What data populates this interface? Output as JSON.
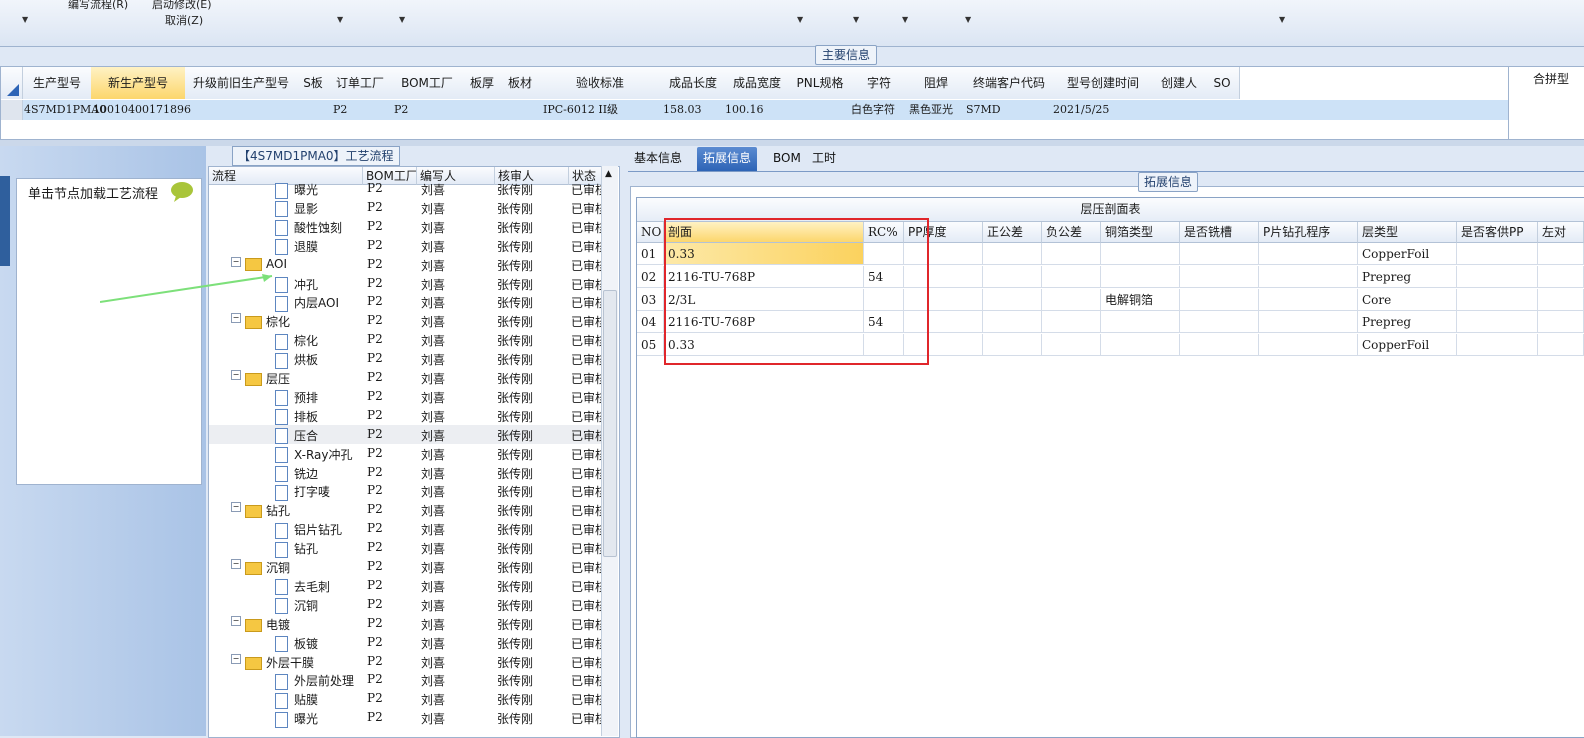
{
  "toolbar": {
    "item_edit_flow": "编写流程(R)",
    "item_start_edit": "启动修改(E)",
    "item_cancel": "取消(Z)"
  },
  "main_info": {
    "title": "主要信息",
    "columns": [
      "生产型号",
      "新生产型号",
      "升级前旧生产型号",
      "S板",
      "订单工厂",
      "BOM工厂",
      "板厚",
      "板材",
      "验收标准",
      "成品长度",
      "成品宽度",
      "PNL规格",
      "字符",
      "阻焊",
      "终端客户代码",
      "型号创建时间",
      "创建人",
      "SO"
    ],
    "row": {
      "prod_model": "4S7MD1PMA0",
      "new_prod_model": "10010400171896",
      "order_factory": "P2",
      "bom_factory": "P2",
      "acceptance": "IPC-6012 II级",
      "length": "158.03",
      "width": "100.16",
      "character": "白色字符",
      "solder_mask": "黑色亚光",
      "customer_code": "S7MD",
      "created": "2021/5/25"
    },
    "right_header": "合拼型"
  },
  "left_panel": {
    "hint": "单击节点加载工艺流程"
  },
  "process_tree": {
    "title": "【4S7MD1PMA0】工艺流程",
    "columns": [
      "流程",
      "BOM工厂",
      "编写人",
      "核审人",
      "状态"
    ],
    "rows": [
      {
        "indent": 2,
        "type": "doc",
        "name": "曝光",
        "bom": "P2",
        "writer": "刘喜",
        "reviewer": "张传刚",
        "status": "已审核"
      },
      {
        "indent": 2,
        "type": "doc",
        "name": "显影",
        "bom": "P2",
        "writer": "刘喜",
        "reviewer": "张传刚",
        "status": "已审核"
      },
      {
        "indent": 2,
        "type": "doc",
        "name": "酸性蚀刻",
        "bom": "P2",
        "writer": "刘喜",
        "reviewer": "张传刚",
        "status": "已审核"
      },
      {
        "indent": 2,
        "type": "doc",
        "name": "退膜",
        "bom": "P2",
        "writer": "刘喜",
        "reviewer": "张传刚",
        "status": "已审核"
      },
      {
        "indent": 1,
        "type": "folder",
        "name": "AOI",
        "bom": "P2",
        "writer": "刘喜",
        "reviewer": "张传刚",
        "status": "已审核"
      },
      {
        "indent": 2,
        "type": "doc",
        "name": "冲孔",
        "bom": "P2",
        "writer": "刘喜",
        "reviewer": "张传刚",
        "status": "已审核"
      },
      {
        "indent": 2,
        "type": "doc",
        "name": "内层AOI",
        "bom": "P2",
        "writer": "刘喜",
        "reviewer": "张传刚",
        "status": "已审核"
      },
      {
        "indent": 1,
        "type": "folder",
        "name": "棕化",
        "bom": "P2",
        "writer": "刘喜",
        "reviewer": "张传刚",
        "status": "已审核"
      },
      {
        "indent": 2,
        "type": "doc",
        "name": "棕化",
        "bom": "P2",
        "writer": "刘喜",
        "reviewer": "张传刚",
        "status": "已审核"
      },
      {
        "indent": 2,
        "type": "doc",
        "name": "烘板",
        "bom": "P2",
        "writer": "刘喜",
        "reviewer": "张传刚",
        "status": "已审核"
      },
      {
        "indent": 1,
        "type": "folder",
        "name": "层压",
        "bom": "P2",
        "writer": "刘喜",
        "reviewer": "张传刚",
        "status": "已审核"
      },
      {
        "indent": 2,
        "type": "doc",
        "name": "预排",
        "bom": "P2",
        "writer": "刘喜",
        "reviewer": "张传刚",
        "status": "已审核"
      },
      {
        "indent": 2,
        "type": "doc",
        "name": "排板",
        "bom": "P2",
        "writer": "刘喜",
        "reviewer": "张传刚",
        "status": "已审核"
      },
      {
        "indent": 2,
        "type": "doc",
        "name": "压合",
        "bom": "P2",
        "writer": "刘喜",
        "reviewer": "张传刚",
        "status": "已审核",
        "selected": true
      },
      {
        "indent": 2,
        "type": "doc",
        "name": "X-Ray冲孔",
        "bom": "P2",
        "writer": "刘喜",
        "reviewer": "张传刚",
        "status": "已审核"
      },
      {
        "indent": 2,
        "type": "doc",
        "name": "铣边",
        "bom": "P2",
        "writer": "刘喜",
        "reviewer": "张传刚",
        "status": "已审核"
      },
      {
        "indent": 2,
        "type": "doc",
        "name": "打字唛",
        "bom": "P2",
        "writer": "刘喜",
        "reviewer": "张传刚",
        "status": "已审核"
      },
      {
        "indent": 1,
        "type": "folder",
        "name": "钻孔",
        "bom": "P2",
        "writer": "刘喜",
        "reviewer": "张传刚",
        "status": "已审核"
      },
      {
        "indent": 2,
        "type": "doc",
        "name": "铝片钻孔",
        "bom": "P2",
        "writer": "刘喜",
        "reviewer": "张传刚",
        "status": "已审核"
      },
      {
        "indent": 2,
        "type": "doc",
        "name": "钻孔",
        "bom": "P2",
        "writer": "刘喜",
        "reviewer": "张传刚",
        "status": "已审核"
      },
      {
        "indent": 1,
        "type": "folder",
        "name": "沉铜",
        "bom": "P2",
        "writer": "刘喜",
        "reviewer": "张传刚",
        "status": "已审核"
      },
      {
        "indent": 2,
        "type": "doc",
        "name": "去毛刺",
        "bom": "P2",
        "writer": "刘喜",
        "reviewer": "张传刚",
        "status": "已审核"
      },
      {
        "indent": 2,
        "type": "doc",
        "name": "沉铜",
        "bom": "P2",
        "writer": "刘喜",
        "reviewer": "张传刚",
        "status": "已审核"
      },
      {
        "indent": 1,
        "type": "folder",
        "name": "电镀",
        "bom": "P2",
        "writer": "刘喜",
        "reviewer": "张传刚",
        "status": "已审核"
      },
      {
        "indent": 2,
        "type": "doc",
        "name": "板镀",
        "bom": "P2",
        "writer": "刘喜",
        "reviewer": "张传刚",
        "status": "已审核"
      },
      {
        "indent": 1,
        "type": "folder",
        "name": "外层干膜",
        "bom": "P2",
        "writer": "刘喜",
        "reviewer": "张传刚",
        "status": "已审核"
      },
      {
        "indent": 2,
        "type": "doc",
        "name": "外层前处理",
        "bom": "P2",
        "writer": "刘喜",
        "reviewer": "张传刚",
        "status": "已审核"
      },
      {
        "indent": 2,
        "type": "doc",
        "name": "贴膜",
        "bom": "P2",
        "writer": "刘喜",
        "reviewer": "张传刚",
        "status": "已审核"
      },
      {
        "indent": 2,
        "type": "doc",
        "name": "曝光",
        "bom": "P2",
        "writer": "刘喜",
        "reviewer": "张传刚",
        "status": "已审核"
      }
    ]
  },
  "tabs": [
    "基本信息",
    "拓展信息",
    "BOM",
    "工时"
  ],
  "ext_info": {
    "title": "拓展信息",
    "table_title": "层压剖面表",
    "columns": [
      "NO",
      "剖面",
      "RC%",
      "PP厚度",
      "正公差",
      "负公差",
      "铜箔类型",
      "是否铣槽",
      "P片钻孔程序",
      "层类型",
      "是否客供PP",
      "左对"
    ],
    "rows": [
      {
        "no": "01",
        "section": "0.33",
        "rc": "",
        "copper": "",
        "layer_type": "CopperFoil"
      },
      {
        "no": "02",
        "section": "2116-TU-768P",
        "rc": "54",
        "copper": "",
        "layer_type": "Prepreg"
      },
      {
        "no": "03",
        "section": "2/3L",
        "rc": "",
        "copper": "电解铜箔",
        "layer_type": "Core"
      },
      {
        "no": "04",
        "section": "2116-TU-768P",
        "rc": "54",
        "copper": "",
        "layer_type": "Prepreg"
      },
      {
        "no": "05",
        "section": "0.33",
        "rc": "",
        "copper": "",
        "layer_type": "CopperFoil"
      }
    ]
  },
  "colors": {
    "accent": "#2d64b6",
    "header_selected": "#fcd66c",
    "row_selected": "#cde2f7",
    "annotation_box": "#e0262b",
    "annotation_arrow": "#7de07a"
  }
}
